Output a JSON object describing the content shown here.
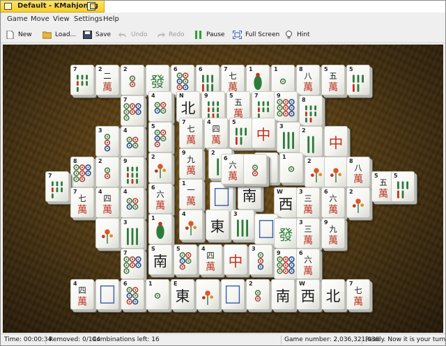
{
  "window": {
    "title": "Default - KMahjongg"
  },
  "menu": [
    "Game",
    "Move",
    "View",
    "Settings",
    "Help"
  ],
  "toolbar": {
    "new": "New",
    "load": "Load...",
    "save": "Save",
    "undo": "Undo",
    "redo": "Redo",
    "pause": "Pause",
    "fullscreen": "Full Screen",
    "hint": "Hint"
  },
  "status": {
    "time": "Time: 00:00:34",
    "removed": "Removed: 0/144",
    "combinations": "Combinations left: 16",
    "game_number": "Game number: 2,036,321,436",
    "ready": "Ready. Now it is your turn."
  },
  "tiles": [
    {
      "k": "b7",
      "label": "7",
      "n": "bamboo-7"
    },
    {
      "k": "c2",
      "label": "2",
      "n": "character-2"
    },
    {
      "k": "d2",
      "label": "2",
      "n": "dot-2"
    },
    {
      "k": "gd",
      "label": "",
      "n": "green-dragon"
    },
    {
      "k": "d6",
      "label": "6",
      "n": "dot-6"
    },
    {
      "k": "b6",
      "label": "6",
      "n": "bamboo-6"
    },
    {
      "k": "c7",
      "label": "7",
      "n": "character-7"
    },
    {
      "k": "b1",
      "label": "1",
      "n": "bamboo-1"
    },
    {
      "k": "d1",
      "label": "1",
      "n": "dot-1"
    },
    {
      "k": "c8",
      "label": "8",
      "n": "character-8"
    },
    {
      "k": "c5",
      "label": "5",
      "n": "character-5"
    },
    {
      "k": "b5",
      "label": "5",
      "n": "bamboo-5"
    },
    {
      "k": "d7",
      "label": "7",
      "n": "dot-7"
    },
    {
      "k": "d4",
      "label": "4",
      "n": "dot-4"
    },
    {
      "k": "wn",
      "label": "N",
      "n": "north-wind"
    },
    {
      "k": "b9",
      "label": "9",
      "n": "bamboo-9"
    },
    {
      "k": "c5",
      "label": "5",
      "n": "character-5"
    },
    {
      "k": "b7",
      "label": "7",
      "n": "bamboo-7"
    },
    {
      "k": "d9",
      "label": "9",
      "n": "dot-9"
    },
    {
      "k": "b8",
      "label": "8",
      "n": "bamboo-8"
    },
    {
      "k": "d3",
      "label": "3",
      "n": "dot-3"
    },
    {
      "k": "d4",
      "label": "4",
      "n": "dot-4"
    },
    {
      "k": "d5",
      "label": "5",
      "n": "dot-5"
    },
    {
      "k": "c7",
      "label": "7",
      "n": "character-7"
    },
    {
      "k": "c4",
      "label": "4",
      "n": "character-4"
    },
    {
      "k": "b5",
      "label": "5",
      "n": "bamboo-5"
    },
    {
      "k": "rd",
      "label": "",
      "n": "red-dragon"
    },
    {
      "k": "b3",
      "label": "3",
      "n": "bamboo-3"
    },
    {
      "k": "b2",
      "label": "2",
      "n": "bamboo-2"
    },
    {
      "k": "rd",
      "label": "",
      "n": "red-dragon"
    },
    {
      "k": "d8",
      "label": "8",
      "n": "dot-8"
    },
    {
      "k": "d2",
      "label": "2",
      "n": "dot-2"
    },
    {
      "k": "b9",
      "label": "9",
      "n": "bamboo-9"
    },
    {
      "k": "fl",
      "label": "2",
      "n": "flower-2"
    },
    {
      "k": "c9",
      "label": "9",
      "n": "character-9"
    },
    {
      "k": "b2",
      "label": "2",
      "n": "bamboo-2"
    },
    {
      "k": "c6",
      "label": "6",
      "n": "character-6"
    },
    {
      "k": "d3",
      "label": "3",
      "n": "dot-3"
    },
    {
      "k": "d1",
      "label": "1",
      "n": "dot-1"
    },
    {
      "k": "fl",
      "label": "2",
      "n": "flower-2"
    },
    {
      "k": "fl",
      "label": "",
      "n": "flower"
    },
    {
      "k": "c8",
      "label": "8",
      "n": "character-8"
    },
    {
      "k": "b7",
      "label": "7",
      "n": "bamboo-7"
    },
    {
      "k": "c7",
      "label": "7",
      "n": "character-7"
    },
    {
      "k": "c4",
      "label": "4",
      "n": "character-4"
    },
    {
      "k": "d4",
      "label": "4",
      "n": "dot-4"
    },
    {
      "k": "c6",
      "label": "6",
      "n": "character-6"
    },
    {
      "k": "c1",
      "label": "1",
      "n": "character-1"
    },
    {
      "k": "wd",
      "label": "",
      "n": "white-dragon"
    },
    {
      "k": "ws",
      "label": "",
      "n": "south-wind"
    },
    {
      "k": "ww",
      "label": "W",
      "n": "west-wind"
    },
    {
      "k": "c3",
      "label": "3",
      "n": "character-3"
    },
    {
      "k": "c6",
      "label": "6",
      "n": "character-6"
    },
    {
      "k": "fl",
      "label": "2",
      "n": "flower-2"
    },
    {
      "k": "c5",
      "label": "5",
      "n": "character-5"
    },
    {
      "k": "b5",
      "label": "5",
      "n": "bamboo-5"
    },
    {
      "k": "fl",
      "label": "",
      "n": "flower"
    },
    {
      "k": "b3",
      "label": "3",
      "n": "bamboo-3"
    },
    {
      "k": "b1",
      "label": "1",
      "n": "bamboo-1"
    },
    {
      "k": "fl",
      "label": "4",
      "n": "flower-4"
    },
    {
      "k": "we",
      "label": "",
      "n": "east-wind"
    },
    {
      "k": "b3",
      "label": "3",
      "n": "bamboo-3"
    },
    {
      "k": "wd",
      "label": "",
      "n": "white-dragon"
    },
    {
      "k": "gd",
      "label": "",
      "n": "green-dragon"
    },
    {
      "k": "c3",
      "label": "3",
      "n": "character-3"
    },
    {
      "k": "c9",
      "label": "9",
      "n": "character-9"
    },
    {
      "k": "d7",
      "label": "7",
      "n": "dot-7"
    },
    {
      "k": "ws",
      "label": "S",
      "n": "south-wind"
    },
    {
      "k": "d5",
      "label": "5",
      "n": "dot-5"
    },
    {
      "k": "c4",
      "label": "4",
      "n": "character-4"
    },
    {
      "k": "rd",
      "label": "",
      "n": "red-dragon"
    },
    {
      "k": "d3",
      "label": "3",
      "n": "dot-3"
    },
    {
      "k": "d9",
      "label": "9",
      "n": "dot-9"
    },
    {
      "k": "c6",
      "label": "6",
      "n": "character-6"
    },
    {
      "k": "c4",
      "label": "4",
      "n": "character-4"
    },
    {
      "k": "wd",
      "label": "",
      "n": "white-dragon"
    },
    {
      "k": "d6",
      "label": "6",
      "n": "dot-6"
    },
    {
      "k": "d1",
      "label": "1",
      "n": "dot-1"
    },
    {
      "k": "we",
      "label": "E",
      "n": "east-wind"
    },
    {
      "k": "fl",
      "label": "",
      "n": "flower"
    },
    {
      "k": "wd",
      "label": "",
      "n": "white-dragon"
    },
    {
      "k": "d2",
      "label": "2",
      "n": "dot-2"
    },
    {
      "k": "ws",
      "label": "",
      "n": "south-wind"
    },
    {
      "k": "ww",
      "label": "W",
      "n": "west-wind"
    },
    {
      "k": "wn",
      "label": "",
      "n": "north-wind"
    },
    {
      "k": "c7",
      "label": "7",
      "n": "character-7"
    },
    {
      "k": "c6",
      "label": "6",
      "n": "character-6"
    },
    {
      "k": "d2",
      "label": "",
      "n": "dot-2"
    }
  ]
}
